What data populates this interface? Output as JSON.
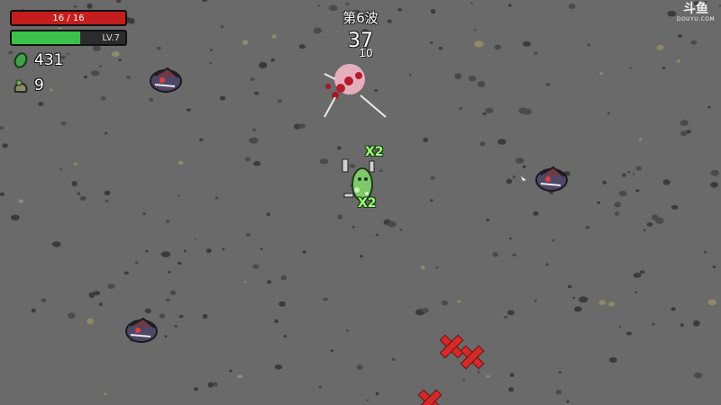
{
  "hud": {
    "hp": {
      "current": 16,
      "max": 16,
      "label": "16 / 16",
      "color": "#c41d1d"
    },
    "xp": {
      "label": "LV.7",
      "fill_fraction": 0.6,
      "color": "#3cc24a"
    },
    "materials": {
      "count": "431",
      "icon": "green-material-icon"
    },
    "bag": {
      "count": "9",
      "icon": "material-bag-icon"
    }
  },
  "wave": {
    "label": "第6波",
    "timer": "37"
  },
  "combat_text": {
    "damage": "10",
    "multipliers": [
      "X2",
      "X2"
    ]
  },
  "watermark": {
    "brand": "斗鱼",
    "domain": "DOUYU.COM"
  },
  "entities": {
    "player": {
      "name": "potato-player",
      "color": "#7fc96b"
    },
    "enemies": [
      {
        "name": "purple-alien-enemy"
      },
      {
        "name": "purple-alien-enemy"
      },
      {
        "name": "purple-alien-enemy"
      }
    ],
    "spawn_markers": {
      "name": "enemy-spawn-marker",
      "count": 3,
      "color": "#d42a2a"
    }
  },
  "colors": {
    "ground": "#6a6a6a",
    "rock": "#3b3b3b",
    "hit_flash": "#f4b6c6"
  }
}
